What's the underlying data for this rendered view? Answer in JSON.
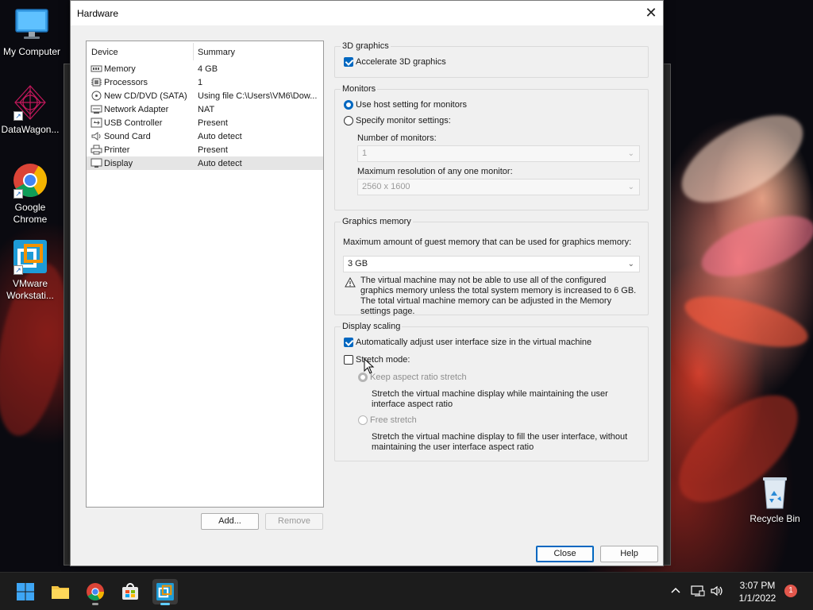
{
  "desktop": {
    "icons": [
      {
        "label": "My Computer",
        "icon": "monitor-icon"
      },
      {
        "label": "DataWagon...",
        "icon": "datawagon-icon"
      },
      {
        "label": "Google Chrome",
        "icon": "chrome-icon"
      },
      {
        "label": "VMware Workstati...",
        "icon": "vmware-icon"
      },
      {
        "label": "Recycle Bin",
        "icon": "recycle-bin-icon"
      }
    ]
  },
  "dialog": {
    "title": "Hardware",
    "close_glyph": "✕",
    "device_list": {
      "headers": {
        "device": "Device",
        "summary": "Summary"
      },
      "rows": [
        {
          "device": "Memory",
          "summary": "4 GB",
          "icon": "memory-icon"
        },
        {
          "device": "Processors",
          "summary": "1",
          "icon": "processor-icon"
        },
        {
          "device": "New CD/DVD (SATA)",
          "summary": "Using file C:\\Users\\VM6\\Dow...",
          "icon": "cd-dvd-icon"
        },
        {
          "device": "Network Adapter",
          "summary": "NAT",
          "icon": "network-adapter-icon"
        },
        {
          "device": "USB Controller",
          "summary": "Present",
          "icon": "usb-icon"
        },
        {
          "device": "Sound Card",
          "summary": "Auto detect",
          "icon": "sound-icon"
        },
        {
          "device": "Printer",
          "summary": "Present",
          "icon": "printer-icon"
        },
        {
          "device": "Display",
          "summary": "Auto detect",
          "icon": "display-icon",
          "selected": true
        }
      ],
      "add_label": "Add...",
      "remove_label": "Remove"
    },
    "graphics_3d": {
      "legend": "3D graphics",
      "accelerate_label": "Accelerate 3D graphics",
      "accelerate_checked": true
    },
    "monitors": {
      "legend": "Monitors",
      "use_host_label": "Use host setting for monitors",
      "specify_label": "Specify monitor settings:",
      "selected": "use_host",
      "num_monitors_label": "Number of monitors:",
      "num_monitors_value": "1",
      "max_res_label": "Maximum resolution of any one monitor:",
      "max_res_value": "2560 x 1600"
    },
    "graphics_memory": {
      "legend": "Graphics memory",
      "max_label": "Maximum amount of guest memory that can be used for graphics memory:",
      "value": "3 GB",
      "warning": "The virtual machine may not be able to use all of the configured graphics memory unless the total system memory is increased to 6 GB. The total virtual machine memory can be adjusted in the Memory settings page."
    },
    "display_scaling": {
      "legend": "Display scaling",
      "auto_adjust_label": "Automatically adjust user interface size in the virtual machine",
      "auto_adjust_checked": true,
      "stretch_label": "Stretch mode:",
      "stretch_checked": false,
      "keep_aspect_label": "Keep aspect ratio stretch",
      "keep_aspect_desc": "Stretch the virtual machine display while maintaining the user interface aspect ratio",
      "free_stretch_label": "Free stretch",
      "free_stretch_desc": "Stretch the virtual machine display to fill the user interface, without maintaining the user interface aspect ratio"
    },
    "footer": {
      "close_label": "Close",
      "help_label": "Help"
    }
  },
  "taskbar": {
    "apps": [
      "start-icon",
      "file-explorer-icon",
      "chrome-icon",
      "store-icon",
      "vmware-icon"
    ],
    "time": "3:07 PM",
    "date": "1/1/2022",
    "notification_count": "1"
  },
  "colors": {
    "accent": "#0067c0",
    "taskbar": "#1c1c1c"
  }
}
